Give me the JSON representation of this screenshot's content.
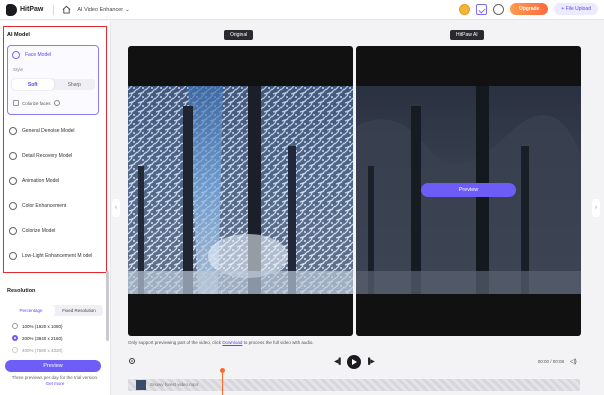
{
  "app": {
    "name": "HitPaw",
    "tool": "AI Video Enhancer"
  },
  "header": {
    "upgrade_label": "Upgrade",
    "upload_label": "+ File Upload"
  },
  "sidebar": {
    "ai_model_title": "AI Model",
    "face_model": {
      "label": "Face Model",
      "style_label": "Style",
      "soft": "Soft",
      "sharp": "Sharp",
      "colorize": "Colorize faces"
    },
    "models": [
      {
        "label": "General Denoise Model",
        "icon": "denoise-icon"
      },
      {
        "label": "Detail Recovery Model",
        "icon": "detail-icon"
      },
      {
        "label": "Animation Model",
        "icon": "animation-icon"
      },
      {
        "label": "Color Enhancement",
        "icon": "color-icon"
      },
      {
        "label": "Colorize Model",
        "icon": "colorize-icon"
      },
      {
        "label": "Low-Light Enhancement M odel",
        "icon": "lowlight-icon"
      }
    ],
    "resolution_title": "Resolution",
    "res_tabs": [
      "Percentage",
      "Fixed Resolution"
    ],
    "res_options": [
      "100% (1920 x 1080)",
      "200% (3840 x 2160)",
      "400% (7680 x 4320)"
    ],
    "preview_label": "Preview",
    "note_text": "Three previews per day for the trial version.",
    "note_link": "Get more"
  },
  "main": {
    "original_tag": "Original",
    "ai_tag": "HitPaw AI",
    "preview_label": "Preview",
    "tip_text": "Only support previewing part of the video, click",
    "tip_link": "Download",
    "tip_tail": "to process the full video with audio.",
    "time": "00:00 / 00:08",
    "clip_label": "Snowy forest video.mp4"
  },
  "colors": {
    "accent": "#6f5ef5",
    "highlight": "#e8282f",
    "upgrade": "#ff7a3d"
  }
}
